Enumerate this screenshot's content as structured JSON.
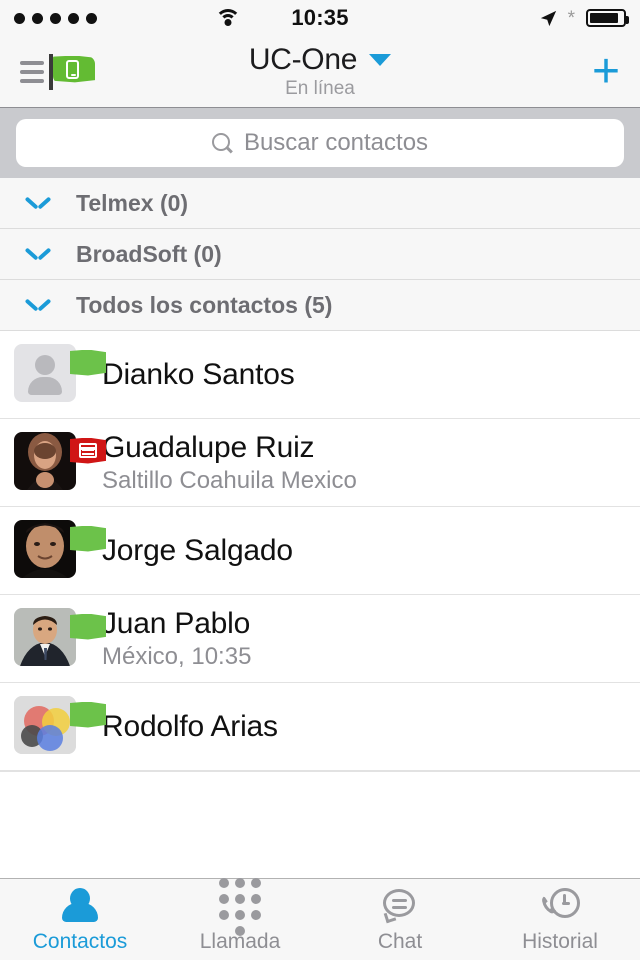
{
  "status_bar": {
    "signal_dots": 5,
    "wifi_icon": "wifi-icon",
    "time": "10:35",
    "location_icon": "location-arrow-icon",
    "bluetooth_icon": "bluetooth-icon",
    "battery_icon": "battery-icon",
    "battery_level": 86
  },
  "header": {
    "menu_icon": "hamburger-menu-icon",
    "logo_icon": "green-flag-device-icon",
    "title": "UC-One",
    "dropdown_icon": "chevron-down-icon",
    "subtitle": "En línea",
    "add_label": "+",
    "accent_color": "#1b9bd8"
  },
  "search": {
    "icon": "search-icon",
    "placeholder": "Buscar contactos",
    "value": ""
  },
  "groups": [
    {
      "label": "Telmex (0)",
      "icon": "chevron-down-icon",
      "expanded": false
    },
    {
      "label": "BroadSoft (0)",
      "icon": "chevron-down-icon",
      "expanded": false
    },
    {
      "label": "Todos los contactos (5)",
      "icon": "chevron-down-icon",
      "expanded": true
    }
  ],
  "contacts": [
    {
      "name": "Dianko Santos",
      "subtitle": "",
      "avatar_type": "placeholder",
      "status": "available",
      "status_color": "#6cc24a",
      "status_icon": "green-flag-icon"
    },
    {
      "name": "Guadalupe Ruiz",
      "subtitle": "Saltillo Coahuila Mexico",
      "avatar_type": "photo-woman",
      "status": "busy",
      "status_color": "#d01616",
      "status_icon": "red-flag-calendar-icon"
    },
    {
      "name": "Jorge Salgado",
      "subtitle": "",
      "avatar_type": "photo-man-dark",
      "status": "available",
      "status_color": "#6cc24a",
      "status_icon": "green-flag-icon"
    },
    {
      "name": "Juan Pablo",
      "subtitle": "México, 10:35",
      "avatar_type": "photo-man-suit",
      "status": "available",
      "status_color": "#6cc24a",
      "status_icon": "green-flag-icon"
    },
    {
      "name": "Rodolfo Arias",
      "subtitle": "",
      "avatar_type": "venn-diagram",
      "status": "available",
      "status_color": "#6cc24a",
      "status_icon": "green-flag-icon"
    }
  ],
  "tabs": [
    {
      "label": "Contactos",
      "icon": "person-icon",
      "active": true
    },
    {
      "label": "Llamada",
      "icon": "dialpad-icon",
      "active": false
    },
    {
      "label": "Chat",
      "icon": "chat-bubble-icon",
      "active": false
    },
    {
      "label": "Historial",
      "icon": "phone-clock-icon",
      "active": false
    }
  ]
}
